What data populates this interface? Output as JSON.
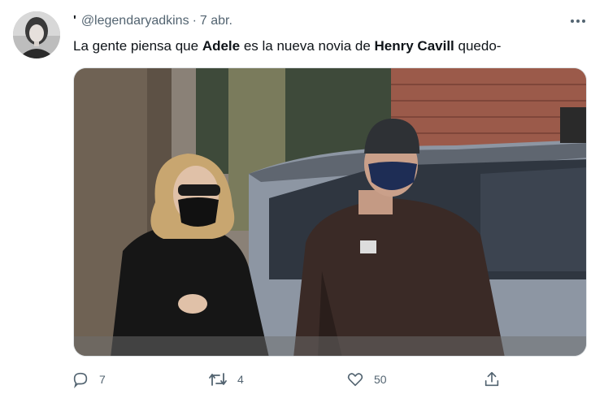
{
  "tweet": {
    "display_name": "'",
    "handle": "@legendaryadkins",
    "separator": "·",
    "timestamp": "7 abr.",
    "text_parts": {
      "p1": "La gente piensa que ",
      "b1": "Adele",
      "p2": " es la nueva novia de ",
      "b2": "Henry Cavill",
      "p3": " quedo-"
    }
  },
  "actions": {
    "reply_count": "7",
    "retweet_count": "4",
    "like_count": "50"
  },
  "icons": {
    "reply": "reply-icon",
    "retweet": "retweet-icon",
    "like": "heart-icon",
    "share": "share-icon",
    "more": "more-icon"
  },
  "colors": {
    "secondary_text": "#536471",
    "primary_text": "#0f1419"
  }
}
